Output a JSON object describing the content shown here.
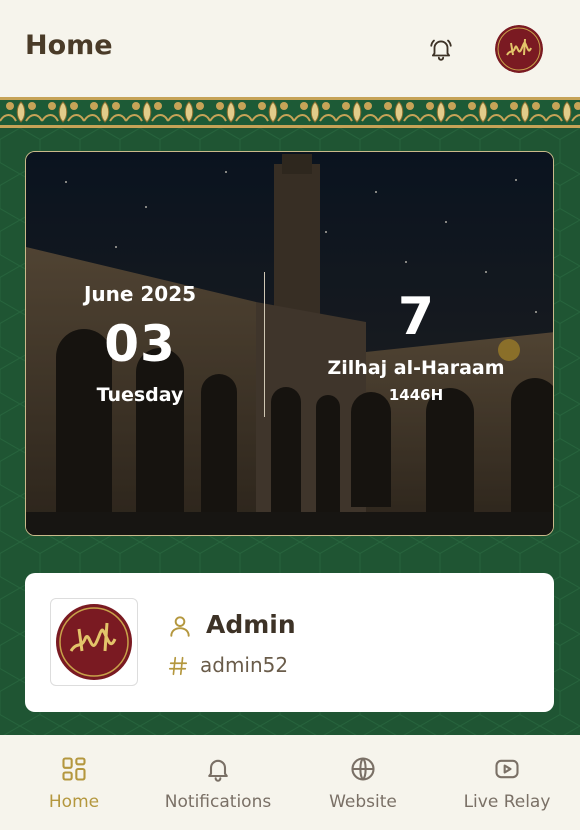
{
  "header": {
    "title": "Home"
  },
  "date_card": {
    "gregorian": {
      "month_year": "June 2025",
      "day": "03",
      "weekday": "Tuesday"
    },
    "hijri": {
      "day": "7",
      "month": "Zilhaj al-Haraam",
      "year": "1446H"
    }
  },
  "profile": {
    "name": "Admin",
    "handle": "admin52"
  },
  "bottom_nav": {
    "items": [
      {
        "label": "Home",
        "icon": "grid-icon",
        "active": true
      },
      {
        "label": "Notifications",
        "icon": "bell-icon",
        "active": false
      },
      {
        "label": "Website",
        "icon": "globe-icon",
        "active": false
      },
      {
        "label": "Live Relay",
        "icon": "youtube-icon",
        "active": false
      }
    ]
  },
  "colors": {
    "accent": "#b4973e",
    "green": "#1f5533",
    "header_bg": "#f6f4ec",
    "logo_red": "#7a1a22"
  }
}
